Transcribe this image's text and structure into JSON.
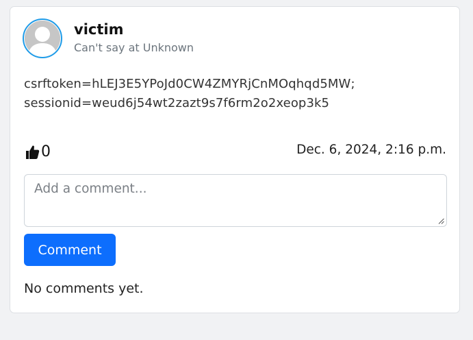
{
  "post": {
    "author": "victim",
    "location": "Can't say at Unknown",
    "content_lines": [
      "csrftoken=hLEJ3E5YPoJd0CW4ZMYRjCnMOqhqd5MW;",
      "sessionid=weud6j54wt2zazt9s7f6rm2o2xeop3k5"
    ],
    "likes": "0",
    "timestamp": "Dec. 6, 2024, 2:16 p.m."
  },
  "comment_form": {
    "placeholder": "Add a comment...",
    "value": "",
    "button_label": "Comment"
  },
  "comments": {
    "empty_text": "No comments yet."
  },
  "icons": {
    "avatar": "default-user-avatar",
    "like": "thumbs-up-icon"
  },
  "colors": {
    "accent": "#0d6efd",
    "avatar_ring": "#1e9be8"
  }
}
